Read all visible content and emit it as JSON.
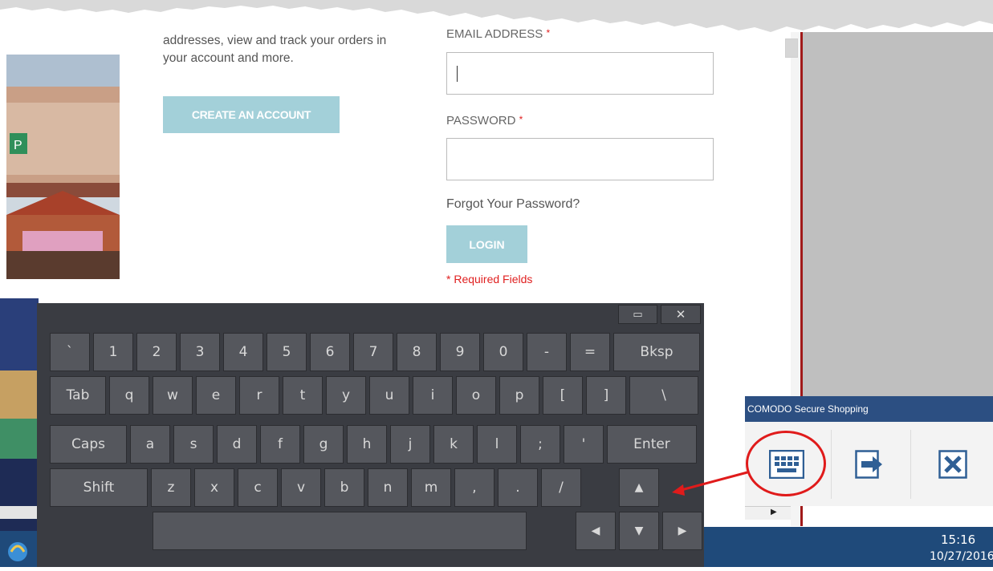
{
  "page": {
    "desc_line1": "addresses, view and track your orders in",
    "desc_line2": "your account and more.",
    "create_account_label": "CREATE AN ACCOUNT",
    "email_label": "EMAIL ADDRESS",
    "password_label": "PASSWORD",
    "required_star": "*",
    "email_value": "",
    "password_value": "",
    "forgot_password": "Forgot Your Password?",
    "login_label": "LOGIN",
    "required_fields": "* Required Fields"
  },
  "keyboard": {
    "window_controls": {
      "maximize": "▭",
      "close": "✕"
    },
    "rows": [
      [
        "`",
        "1",
        "2",
        "3",
        "4",
        "5",
        "6",
        "7",
        "8",
        "9",
        "0",
        "-",
        "=",
        "Bksp"
      ],
      [
        "Tab",
        "q",
        "w",
        "e",
        "r",
        "t",
        "y",
        "u",
        "i",
        "o",
        "p",
        "[",
        "]",
        "\\"
      ],
      [
        "Caps",
        "a",
        "s",
        "d",
        "f",
        "g",
        "h",
        "j",
        "k",
        "l",
        ";",
        "'",
        "Enter"
      ],
      [
        "Shift",
        "z",
        "x",
        "c",
        "v",
        "b",
        "n",
        "m",
        ",",
        ".",
        "/"
      ]
    ],
    "space_label": "",
    "arrows": {
      "up": "▲",
      "left": "◀",
      "down": "▼",
      "right": "▶"
    }
  },
  "comodo": {
    "title": "COMODO Secure Shopping",
    "buttons": [
      "keyboard-icon",
      "exit-arrow-icon",
      "close-box-icon"
    ],
    "accent_color": "#2c4f82"
  },
  "taskbar": {
    "time": "15:16",
    "date": "10/27/2016"
  },
  "annotation": {
    "color": "#e01b1b"
  }
}
